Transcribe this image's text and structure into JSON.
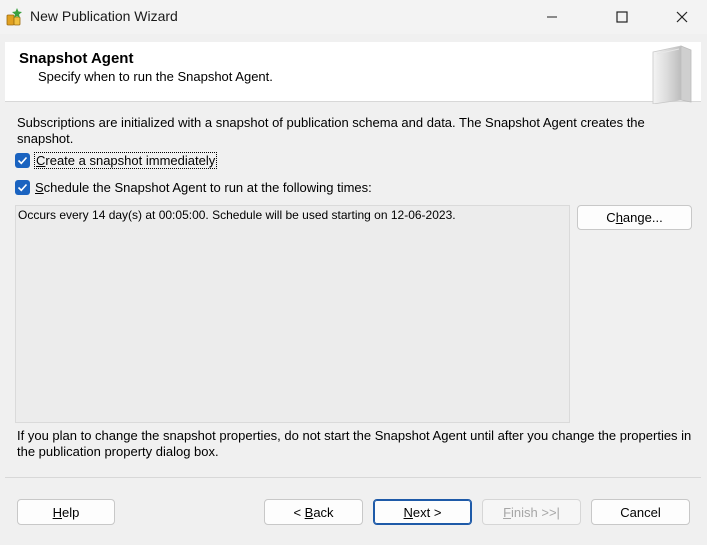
{
  "window": {
    "title": "New Publication Wizard"
  },
  "header": {
    "title": "Snapshot Agent",
    "subtitle": "Specify when to run the Snapshot Agent."
  },
  "description": "Subscriptions are initialized with a snapshot of publication schema and data. The Snapshot Agent creates the snapshot.",
  "options": {
    "create_snapshot": {
      "label_pre": "",
      "label_underlined": "C",
      "label_post": "reate a snapshot immediately",
      "checked": true
    },
    "schedule_agent": {
      "label_pre": "",
      "label_underlined": "S",
      "label_post": "chedule the Snapshot Agent to run at the following times:",
      "checked": true
    }
  },
  "schedule": {
    "text": "Occurs every 14 day(s) at 00:05:00. Schedule will be used starting on 12-06-2023.",
    "change_button": {
      "pre": "C",
      "underlined": "h",
      "post": "ange..."
    }
  },
  "note": "If you plan to change the snapshot properties, do not start the Snapshot Agent until after you change the properties in the publication property dialog box.",
  "buttons": {
    "help": {
      "pre": "",
      "underlined": "H",
      "post": "elp"
    },
    "back": {
      "pre": "< ",
      "underlined": "B",
      "post": "ack"
    },
    "next": {
      "pre": "",
      "underlined": "N",
      "post": "ext >"
    },
    "finish": {
      "pre": "",
      "underlined": "F",
      "post": "inish >>|"
    },
    "cancel": {
      "pre": "",
      "underlined": "",
      "post": "Cancel"
    }
  },
  "colors": {
    "accent": "#1a63c0",
    "dialog_bg": "#f0f0f0",
    "header_bg": "#ffffff"
  },
  "icons": {
    "app": "wizard-app-icon",
    "minimize": "minimize-icon",
    "maximize": "maximize-icon",
    "close": "close-icon",
    "header": "book-graphic-icon",
    "check": "checkmark-icon"
  }
}
